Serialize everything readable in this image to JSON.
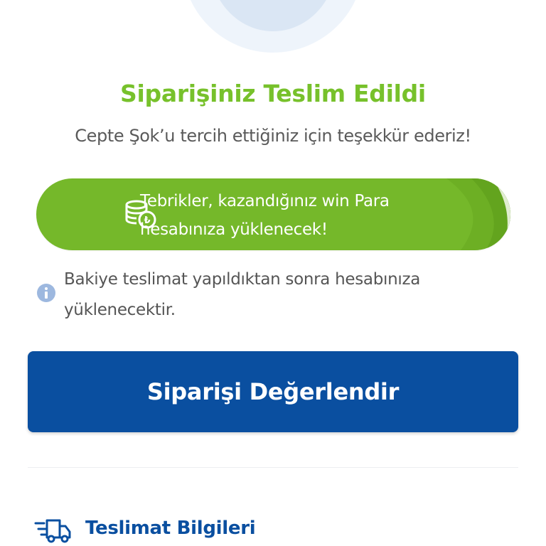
{
  "order": {
    "title": "Siparişiniz Teslim Edildi",
    "subtitle": "Cepte Şok’u tercih ettiğiniz için teşekkür ederiz!"
  },
  "win_banner": {
    "line1": "Tebrikler, kazandığınız win Para",
    "line2": "hesabınıza yüklenecek!",
    "icon": "coin-stack-lira-icon"
  },
  "info": {
    "icon": "info-icon",
    "line1": "Bakiye teslimat yapıldıktan sonra hesabınıza",
    "line2": "yüklenecektir."
  },
  "actions": {
    "rate_label": "Siparişi Değerlendir"
  },
  "delivery": {
    "icon": "delivery-truck-icon",
    "title": "Teslimat Bilgileri"
  },
  "colors": {
    "success_green": "#77c12b",
    "banner_green": "#75b82a",
    "brand_blue": "#0a4fa0",
    "info_blue": "#9db8df"
  }
}
